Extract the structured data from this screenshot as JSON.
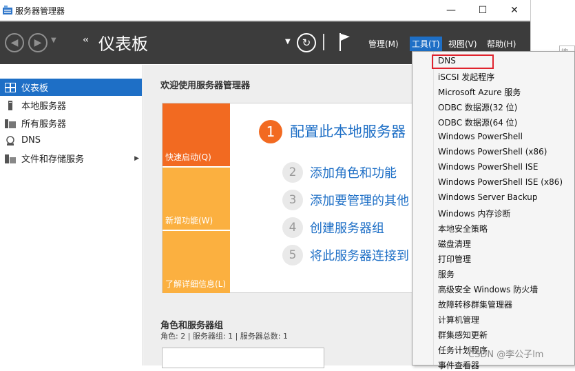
{
  "window": {
    "title": "服务器管理器",
    "minimize": "—",
    "maximize": "☐",
    "close": "✕"
  },
  "nav": {
    "page_title": "仪表板",
    "breadcrumb_sep": "‹‹",
    "menus": {
      "manage": "管理(M)",
      "tools": "工具(T)",
      "view": "视图(V)",
      "help": "帮助(H)"
    },
    "accent": "#1e6fc6"
  },
  "sidebar": {
    "items": [
      {
        "label": "仪表板",
        "icon": "dashboard-icon",
        "active": true
      },
      {
        "label": "本地服务器",
        "icon": "server-icon"
      },
      {
        "label": "所有服务器",
        "icon": "servers-icon"
      },
      {
        "label": "DNS",
        "icon": "dns-icon"
      },
      {
        "label": "文件和存储服务",
        "icon": "storage-icon",
        "expandable": true
      }
    ]
  },
  "main": {
    "welcome": "欢迎使用服务器管理器",
    "tiles": [
      "快速启动(Q)",
      "新增功能(W)",
      "了解详细信息(L)"
    ],
    "tile_colors": {
      "orange": "#f26a21",
      "yellow": "#fbb040"
    },
    "steps": [
      {
        "num": "1",
        "label": "配置此本地服务器"
      },
      {
        "num": "2",
        "label": "添加角色和功能"
      },
      {
        "num": "3",
        "label": "添加要管理的其他"
      },
      {
        "num": "4",
        "label": "创建服务器组"
      },
      {
        "num": "5",
        "label": "将此服务器连接到"
      }
    ],
    "roles_title": "角色和服务器组",
    "roles_summary": "角色: 2 | 服务器组: 1 | 服务器总数: 1"
  },
  "tools_menu": {
    "items": [
      "DNS",
      "iSCSI 发起程序",
      "Microsoft Azure 服务",
      "ODBC 数据源(32 位)",
      "ODBC 数据源(64 位)",
      "Windows PowerShell",
      "Windows PowerShell (x86)",
      "Windows PowerShell ISE",
      "Windows PowerShell ISE (x86)",
      "Windows Server Backup",
      "Windows 内存诊断",
      "本地安全策略",
      "磁盘清理",
      "打印管理",
      "服务",
      "高级安全 Windows 防火墙",
      "故障转移群集管理器",
      "计算机管理",
      "群集感知更新",
      "任务计划程序",
      "事件查看器"
    ],
    "highlight_color": "#e0232d"
  },
  "background_window": {
    "search_placeholder": "搜索\"此"
  },
  "watermark": "CSDN @李公子lm"
}
